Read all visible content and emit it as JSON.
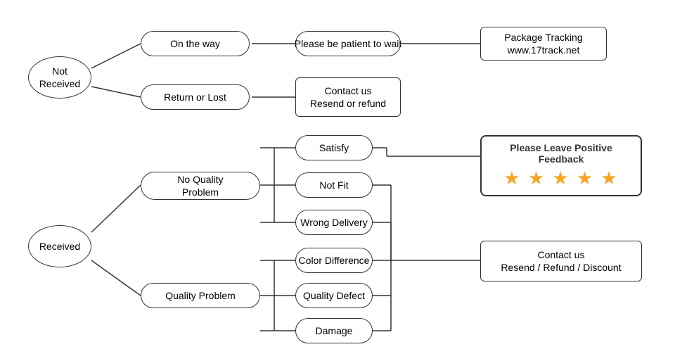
{
  "nodes": {
    "not_received": "Not\nReceived",
    "received": "Received",
    "on_the_way": "On the way",
    "return_or_lost": "Return or Lost",
    "patient": "Please be patient to wait",
    "package_tracking": "Package Tracking\nwww.17track.net",
    "contact_resend_refund": "Contact us\nResend or refund",
    "no_quality_problem": "No Quality\nProblem",
    "quality_problem": "Quality Problem",
    "satisfy": "Satisfy",
    "not_fit": "Not Fit",
    "wrong_delivery": "Wrong Delivery",
    "color_difference": "Color Difference",
    "quality_defect": "Quality Defect",
    "damage": "Damage",
    "feedback_title": "Please Leave Positive Feedback",
    "feedback_stars": "★ ★ ★ ★ ★",
    "contact_resend_refund_discount": "Contact us\nResend / Refund / Discount"
  }
}
